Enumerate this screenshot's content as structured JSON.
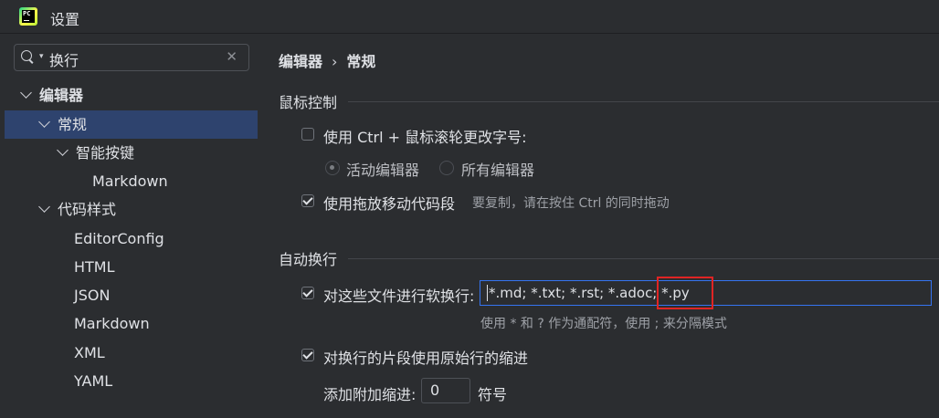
{
  "window": {
    "title": "设置"
  },
  "search": {
    "value": "换行"
  },
  "sidebar": {
    "items": [
      {
        "label": "编辑器"
      },
      {
        "label": "常规"
      },
      {
        "label": "智能按键"
      },
      {
        "label": "Markdown"
      },
      {
        "label": "代码样式"
      },
      {
        "label": "EditorConfig"
      },
      {
        "label": "HTML"
      },
      {
        "label": "JSON"
      },
      {
        "label": "Markdown"
      },
      {
        "label": "XML"
      },
      {
        "label": "YAML"
      }
    ]
  },
  "breadcrumb": {
    "parent": "编辑器",
    "separator": "›",
    "current": "常规"
  },
  "mouse": {
    "section_title": "鼠标控制",
    "ctrl_wheel_label": "使用 Ctrl + 鼠标滚轮更改字号:",
    "radio_active": "活动编辑器",
    "radio_all": "所有编辑器",
    "dnd_label": "使用拖放移动代码段",
    "dnd_hint": "要复制，请在按住 Ctrl 的同时拖动"
  },
  "wrap": {
    "section_title": "自动换行",
    "soft_wrap_label": "对这些文件进行软换行:",
    "soft_wrap_value": "*.md; *.txt; *.rst; *.adoc; *.py",
    "soft_wrap_hint": "使用 * 和 ? 作为通配符，使用 ; 来分隔模式",
    "indent_label": "对换行的片段使用原始行的缩进",
    "extra_indent_label": "添加附加缩进:",
    "extra_indent_value": "0",
    "extra_indent_unit": "符号"
  },
  "colors": {
    "accent": "#3574f0",
    "selection": "#2e436e",
    "highlight": "#e02424",
    "background": "#2b2d30"
  }
}
